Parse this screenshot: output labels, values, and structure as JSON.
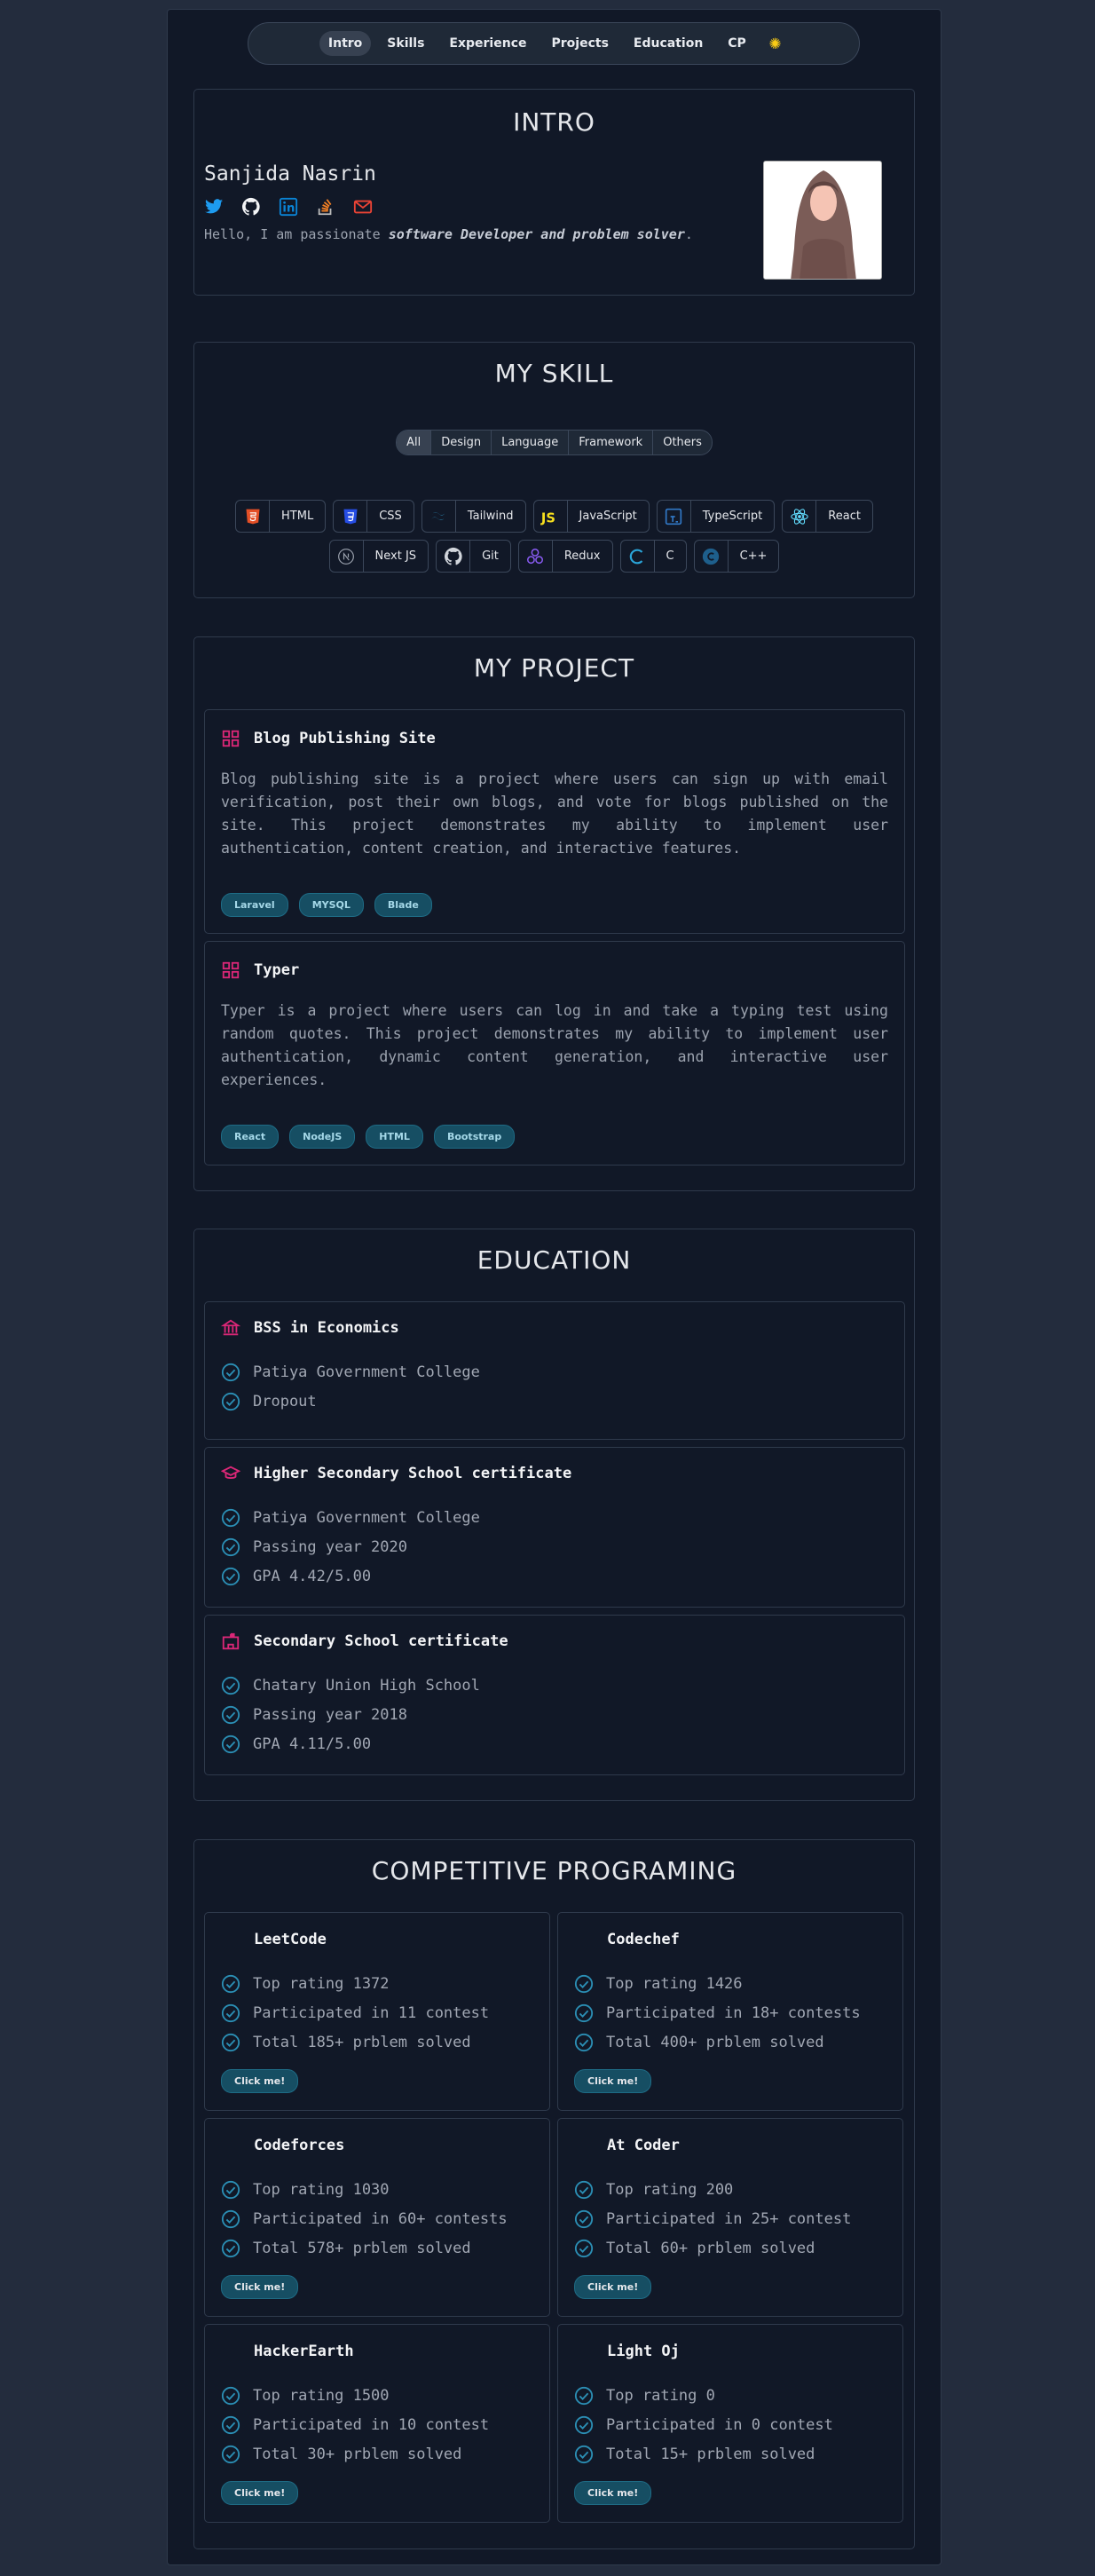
{
  "nav": {
    "items": [
      "Intro",
      "Skills",
      "Experience",
      "Projects",
      "Education",
      "CP"
    ],
    "active": "Intro",
    "theme_icon": "sun-icon"
  },
  "intro": {
    "title": "INTRO",
    "name": "Sanjida Nasrin",
    "social_icons": [
      "twitter-icon",
      "github-icon",
      "linkedin-icon",
      "stackoverflow-icon",
      "email-icon"
    ],
    "text_prefix": "Hello, I am passionate ",
    "text_emphasis": "software Developer and problem solver",
    "text_suffix": "."
  },
  "skills": {
    "title": "MY SKILL",
    "filters": [
      "All",
      "Design",
      "Language",
      "Framework",
      "Others"
    ],
    "active_filter": "All",
    "row1": [
      {
        "label": "HTML",
        "icon": "html-icon",
        "color": "#e34f26"
      },
      {
        "label": "CSS",
        "icon": "css-icon",
        "color": "#264de4"
      },
      {
        "label": "Tailwind",
        "icon": "tailwind-icon",
        "color": "#38bdf8"
      },
      {
        "label": "JavaScript",
        "icon": "javascript-icon",
        "color": "#f7df1e"
      },
      {
        "label": "TypeScript",
        "icon": "typescript-icon",
        "color": "#3178c6"
      },
      {
        "label": "React",
        "icon": "react-icon",
        "color": "#61dafb"
      }
    ],
    "row2": [
      {
        "label": "Next JS",
        "icon": "nextjs-icon",
        "color": "#9ca3af"
      },
      {
        "label": "Git",
        "icon": "git-icon",
        "color": "#d1d5db"
      },
      {
        "label": "Redux",
        "icon": "redux-icon",
        "color": "#764abc"
      },
      {
        "label": "C",
        "icon": "c-icon",
        "color": "#2aa4d8"
      },
      {
        "label": "C++",
        "icon": "cpp-icon",
        "color": "#1e6f9f"
      }
    ]
  },
  "projects": {
    "title": "MY PROJECT",
    "items": [
      {
        "name": "Blog Publishing Site",
        "description": "Blog publishing site is a project where users can sign up with email verification, post their own blogs, and vote for blogs published on the site. This project demonstrates my ability to implement user authentication, content creation, and interactive features.",
        "tags": [
          "Laravel",
          "MYSQL",
          "Blade"
        ]
      },
      {
        "name": "Typer",
        "description": "Typer is a project where users can log in and take a typing test using random quotes. This project demonstrates my ability to implement user authentication, dynamic content generation, and interactive user experiences.",
        "tags": [
          "React",
          "NodeJS",
          "HTML",
          "Bootstrap"
        ]
      }
    ]
  },
  "education": {
    "title": "EDUCATION",
    "items": [
      {
        "name": "BSS in Economics",
        "icon": "bank-icon",
        "details": [
          "Patiya Government College",
          "Dropout"
        ]
      },
      {
        "name": "Higher Secondary School certificate",
        "icon": "graduation-cap-icon",
        "details": [
          "Patiya Government College",
          "Passing year 2020",
          "GPA 4.42/5.00"
        ]
      },
      {
        "name": "Secondary School certificate",
        "icon": "school-icon",
        "details": [
          "Chatary Union High School",
          "Passing year 2018",
          "GPA 4.11/5.00"
        ]
      }
    ]
  },
  "cp": {
    "title": "COMPETITIVE PROGRAMING",
    "button_label": "Click me!",
    "sites": [
      {
        "name": "LeetCode",
        "details": [
          "Top rating 1372",
          "Participated in 11 contest",
          "Total 185+ prblem solved"
        ]
      },
      {
        "name": "Codechef",
        "details": [
          "Top rating 1426",
          "Participated in 18+ contests",
          "Total 400+ prblem solved"
        ]
      },
      {
        "name": "Codeforces",
        "details": [
          "Top rating 1030",
          "Participated in 60+ contests",
          "Total 578+ prblem solved"
        ]
      },
      {
        "name": "At Coder",
        "details": [
          "Top rating 200",
          "Participated in 25+ contest",
          "Total 60+ prblem solved"
        ]
      },
      {
        "name": "HackerEarth",
        "details": [
          "Top rating 1500",
          "Participated in 10 contest",
          "Total 30+ prblem solved"
        ]
      },
      {
        "name": "Light Oj",
        "details": [
          "Top rating 0",
          "Participated in 0 contest",
          "Total 15+ prblem solved"
        ]
      }
    ]
  }
}
